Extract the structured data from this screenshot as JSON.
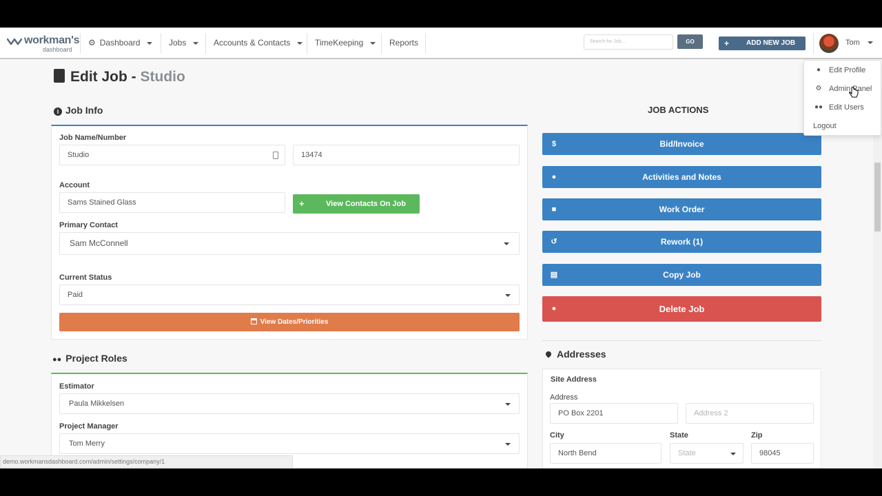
{
  "navbar": {
    "logo_word": "workman's",
    "logo_sub": "dashboard",
    "dashboard": "Dashboard",
    "jobs": "Jobs",
    "accounts": "Accounts & Contacts",
    "timekeeping": "TimeKeeping",
    "reports": "Reports",
    "search_placeholder": "Search for Job...",
    "go": "GO",
    "add_new_job": "ADD NEW JOB",
    "user": "Tom"
  },
  "user_menu": {
    "edit_profile": "Edit Profile",
    "admin_panel": "Admin Panel",
    "edit_users": "Edit Users",
    "logout": "Logout"
  },
  "page": {
    "title_prefix": "Edit Job -",
    "title_job": "Studio"
  },
  "job_info": {
    "heading": "Job Info",
    "name_label": "Job Name/Number",
    "name_value": "Studio",
    "number_value": "13474",
    "account_label": "Account",
    "account_value": "Sams Stained Glass",
    "view_contacts": "View Contacts On Job",
    "primary_contact_label": "Primary Contact",
    "primary_contact_value": "Sam McConnell",
    "status_label": "Current Status",
    "status_value": "Paid",
    "view_dates": "View Dates/Priorities"
  },
  "project_roles": {
    "heading": "Project Roles",
    "estimator_label": "Estimator",
    "estimator_value": "Paula Mikkelsen",
    "pm_label": "Project Manager",
    "pm_value": "Tom Merry"
  },
  "job_actions": {
    "heading": "JOB ACTIONS",
    "bid_invoice": "Bid/Invoice",
    "activities": "Activities and Notes",
    "work_order": "Work Order",
    "rework": "Rework (1)",
    "copy_job": "Copy Job",
    "delete_job": "Delete Job"
  },
  "addresses": {
    "heading": "Addresses",
    "site_address": "Site Address",
    "address_label": "Address",
    "address1": "PO Box 2201",
    "address2_placeholder": "Address 2",
    "city_label": "City",
    "city_value": "North Bend",
    "state_label": "State",
    "state_placeholder": "State",
    "zip_label": "Zip",
    "zip_value": "98045"
  },
  "status_bar_url": "demo.workmansdashboard.com/admin/settings/company/1",
  "colors": {
    "action_blue": "#3a82c4",
    "contacts_green": "#5cb85c",
    "dates_orange": "#e07b4a",
    "delete_red": "#d9534f"
  }
}
